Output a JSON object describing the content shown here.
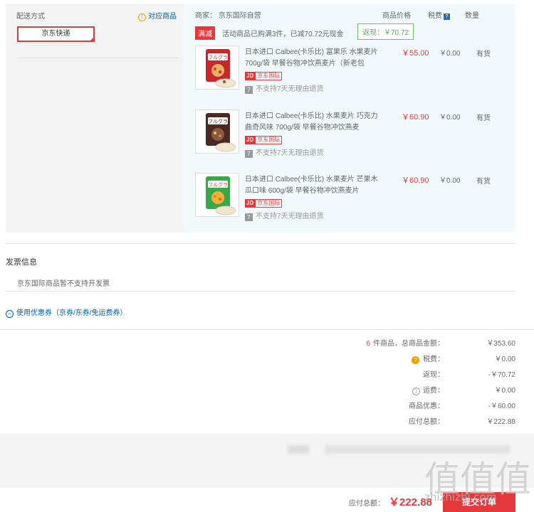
{
  "delivery": {
    "title": "配送方式",
    "match_link": "对应商品",
    "shipping_option": "京东快递"
  },
  "shop": {
    "seller_label": "商家：",
    "seller_name": "京东国际自营",
    "col_price": "商品价格",
    "col_tax": "税费",
    "col_qty": "数量",
    "promo_tag": "满减",
    "promo_text": "活动商品已购满3件，已减70.72元现金",
    "rebate": "返现：￥70.72"
  },
  "items": [
    {
      "name": "日本进口 Calbee(卡乐比) 富果乐 水果麦片700g/袋 早餐谷物冲饮燕麦片（新老包",
      "price": "￥55.00",
      "tax": "￥0.00",
      "stock": "有货",
      "jd": "JD",
      "intl": "京东国际",
      "no_return": "不支持7天无理由退货",
      "bag_color": "#c8272d"
    },
    {
      "name": "日本进口 Calbee(卡乐比) 水果麦片 巧克力曲奇风味 700g/袋 早餐谷物冲饮燕麦",
      "price": "￥60.90",
      "tax": "￥0.00",
      "stock": "有货",
      "jd": "JD",
      "intl": "京东国际",
      "no_return": "不支持7天无理由退货",
      "bag_color": "#4a2a22"
    },
    {
      "name": "日本进口 Calbee(卡乐比) 水果麦片 芒果木瓜口味 600g/袋 早餐谷物冲饮燕麦片",
      "price": "￥60.90",
      "tax": "￥0.00",
      "stock": "有货",
      "jd": "JD",
      "intl": "京东国际",
      "no_return": "不支持7天无理由退货",
      "bag_color": "#3aa84a"
    }
  ],
  "invoice": {
    "title": "发票信息",
    "text": "京东国际商品暂不支持开发票"
  },
  "coupon": {
    "link": "使用优惠券（京券/东券/免运费券）"
  },
  "summary": {
    "count": "6",
    "count_label": "件商品，总商品金额：",
    "total_goods": "￥353.60",
    "tax_label": "税费：",
    "tax": "￥0.00",
    "rebate_label": "返现：",
    "rebate": "-￥70.72",
    "shipping_label": "运费：",
    "shipping": "￥0.00",
    "discount_label": "商品优惠：",
    "discount": "-￥60.00",
    "payable_label": "应付总额：",
    "payable": "￥222.88"
  },
  "footer": {
    "total_label": "应付总额：",
    "total": "￥222.88",
    "submit": "提交订单"
  },
  "watermark": {
    "main": "值值值",
    "sub": "zhizhizhi.com"
  },
  "colors": {
    "accent": "#e4393c",
    "link": "#005ea7",
    "shop_bg": "#f2f9fd"
  }
}
